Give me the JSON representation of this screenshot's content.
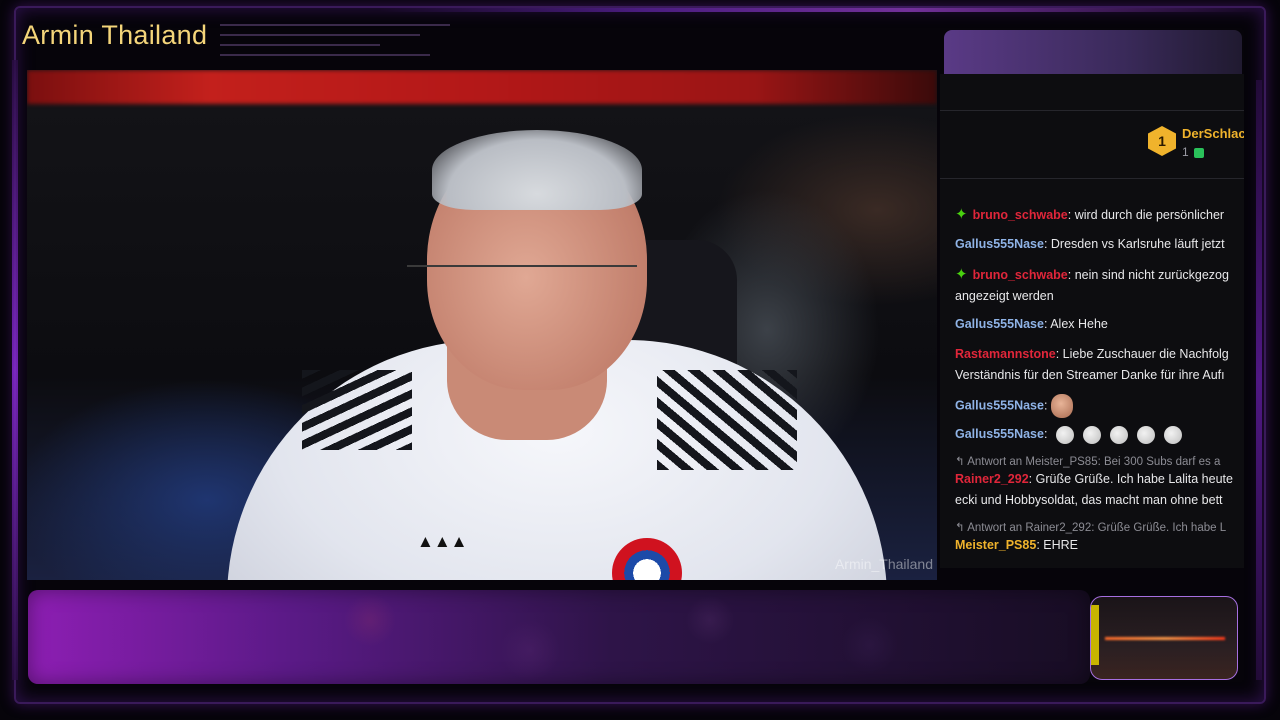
{
  "stream": {
    "channel_title": "Armin Thailand",
    "video_watermark": "Armin_Thailand"
  },
  "chat": {
    "leaderboard": {
      "rank": "1",
      "name": "DerSchlac",
      "count": "1",
      "badge_color": "#f0b32c"
    },
    "messages": [
      {
        "user": "bruno_schwabe",
        "user_color": "#e0263a",
        "badge": "sparkle-icon",
        "text": ": wird durch die persönlicher"
      },
      {
        "user": "Gallus555Nase",
        "user_color": "#8fb3e6",
        "text": ": Dresden vs Karlsruhe läuft jetzt"
      },
      {
        "user": "bruno_schwabe",
        "user_color": "#e0263a",
        "badge": "sparkle-icon",
        "text": ": nein sind nicht zurückgezog",
        "text2": "angezeigt werden"
      },
      {
        "user": "Gallus555Nase",
        "user_color": "#8fb3e6",
        "text": ": Alex Hehe"
      },
      {
        "user": "Rastamannstone",
        "user_color": "#e0263a",
        "text": ": Liebe Zuschauer die Nachfolg",
        "text2": "Verständnis für den Streamer Danke für ihre Aufı"
      },
      {
        "user": "Gallus555Nase",
        "user_color": "#8fb3e6",
        "text": ":",
        "emote": "face-emote"
      },
      {
        "user": "Gallus555Nase",
        "user_color": "#8fb3e6",
        "text": ":",
        "emote": "duck-emote-x5"
      },
      {
        "reply_to": "Antwort an Meister_PS85: Bei 300 Subs darf es a",
        "user": "Rainer2_292",
        "user_color": "#e0263a",
        "text": ": Grüße Grüße. Ich habe Lalita heute",
        "text2": "ecki und Hobbysoldat, das macht man ohne bett"
      },
      {
        "reply_to": "Antwort an Rainer2_292: Grüße Grüße. Ich habe L",
        "user": "Meister_PS85",
        "user_color": "#f0b32c",
        "text": ": EHRE"
      }
    ]
  },
  "colors": {
    "title": "#f4d57a",
    "accent_purple": "#8d1eb3",
    "chat_bg": "#0d0d10"
  }
}
